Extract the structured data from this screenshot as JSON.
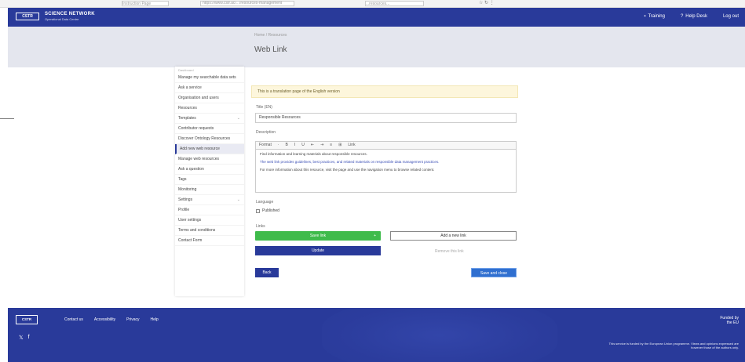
{
  "browser": {
    "tab_text": "Instruction Page",
    "url_text": "https://www.cstr.ac/.../resources-management",
    "url2_text": "...resources...",
    "nav_icons": "☆  ↻  ⋮"
  },
  "header": {
    "logo_box": "CSTR",
    "logo_text": "SCIENCE NETWORK",
    "logo_sub": "Operational Data Centre",
    "links": [
      "Training",
      "Help Desk",
      "Log out"
    ]
  },
  "title_band": {
    "breadcrumb": "Home / Resources",
    "page_title": "Web Link"
  },
  "sidebar": {
    "top_label": "Dashboard",
    "items": [
      {
        "label": "Manage my searchable data sets",
        "active": false,
        "chev": ""
      },
      {
        "label": "Ask a service",
        "active": false,
        "chev": ""
      },
      {
        "label": "Organisation and users",
        "active": false,
        "chev": ""
      },
      {
        "label": "Resources",
        "active": false,
        "chev": ""
      },
      {
        "label": "Templates",
        "active": false,
        "chev": "⌄"
      },
      {
        "label": "Contributor requests",
        "active": false,
        "chev": ""
      },
      {
        "label": "Discover Ontology Resources",
        "active": false,
        "chev": ""
      },
      {
        "label": "Add new web resource",
        "active": true,
        "chev": ""
      },
      {
        "label": "Manage web resources",
        "active": false,
        "chev": ""
      },
      {
        "label": "Ask a question",
        "active": false,
        "chev": ""
      },
      {
        "label": "Tags",
        "active": false,
        "chev": ""
      },
      {
        "label": "Monitoring",
        "active": false,
        "chev": ""
      },
      {
        "label": "Settings",
        "active": false,
        "chev": "⌄"
      },
      {
        "label": "Profile",
        "active": false,
        "chev": ""
      },
      {
        "label": "User settings",
        "active": false,
        "chev": ""
      },
      {
        "label": "Terms and conditions",
        "active": false,
        "chev": ""
      },
      {
        "label": "Contact Form",
        "active": false,
        "chev": ""
      }
    ]
  },
  "form": {
    "alert": "This is a translation page of the English version",
    "title_label": "Title (EN)",
    "title_value": "Responsible Resources",
    "desc_label": "Description",
    "toolbar_items": [
      "Format",
      "·",
      "B",
      "I",
      "U",
      "⇤",
      "⇥",
      "≡",
      "⊞",
      "Link"
    ],
    "editor_p1": "Find information and learning materials about responsible resources.",
    "editor_p2": "The web link provides guidelines, best practices, and related materials on responsible data management practices.",
    "editor_p3": "For more information about this resource, visit the page and use the navigation menu to browse related content.",
    "lang_label": "Language",
    "checkbox_label": "Published",
    "links_label": "Links",
    "btn_green": "Save link",
    "btn_green_icon": "+",
    "btn_outline": "Add a new link",
    "btn_blue_wide": "Update",
    "ghost_text": "Remove this link",
    "btn_back": "Back",
    "btn_save": "Save and close"
  },
  "footer": {
    "logo": "CSTR",
    "links": [
      "Contact us",
      "Accessibility",
      "Privacy",
      "Help"
    ],
    "social": [
      "𝕏",
      "f"
    ],
    "right_logo_line1": "Funded by",
    "right_logo_line2": "the EU",
    "legal": "This service is funded by the European Union programme. Views and opinions expressed are however those of the authors only."
  },
  "colors": {
    "header_blue": "#293a9a",
    "green_button": "#3fbb4b",
    "save_button": "#2f6fd0",
    "alert_bg": "#fdf6dc"
  }
}
